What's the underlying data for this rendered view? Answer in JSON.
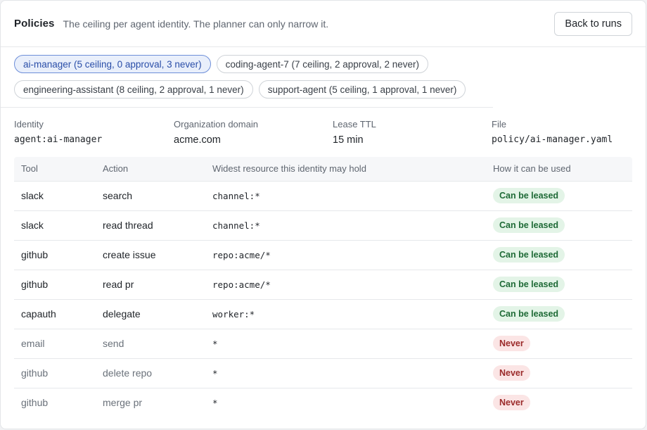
{
  "header": {
    "title": "Policies",
    "subtitle": "The ceiling per agent identity. The planner can only narrow it.",
    "back_label": "Back to runs"
  },
  "chips": [
    {
      "label": "ai-manager (5 ceiling, 0 approval, 3 never)",
      "active": true
    },
    {
      "label": "coding-agent-7 (7 ceiling, 2 approval, 2 never)",
      "active": false
    },
    {
      "label": "engineering-assistant (8 ceiling, 2 approval, 1 never)",
      "active": false
    },
    {
      "label": "support-agent (5 ceiling, 1 approval, 1 never)",
      "active": false
    }
  ],
  "meta": {
    "identity_label": "Identity",
    "identity_value": "agent:ai-manager",
    "domain_label": "Organization domain",
    "domain_value": "acme.com",
    "ttl_label": "Lease TTL",
    "ttl_value": "15 min",
    "file_label": "File",
    "file_value": "policy/ai-manager.yaml"
  },
  "table": {
    "headers": [
      "Tool",
      "Action",
      "Widest resource this identity may hold",
      "How it can be used"
    ],
    "rows": [
      {
        "tool": "slack",
        "action": "search",
        "resource": "channel:*",
        "usage": "Can be leased",
        "status": "leased"
      },
      {
        "tool": "slack",
        "action": "read thread",
        "resource": "channel:*",
        "usage": "Can be leased",
        "status": "leased"
      },
      {
        "tool": "github",
        "action": "create issue",
        "resource": "repo:acme/*",
        "usage": "Can be leased",
        "status": "leased"
      },
      {
        "tool": "github",
        "action": "read pr",
        "resource": "repo:acme/*",
        "usage": "Can be leased",
        "status": "leased"
      },
      {
        "tool": "capauth",
        "action": "delegate",
        "resource": "worker:*",
        "usage": "Can be leased",
        "status": "leased"
      },
      {
        "tool": "email",
        "action": "send",
        "resource": "*",
        "usage": "Never",
        "status": "never"
      },
      {
        "tool": "github",
        "action": "delete repo",
        "resource": "*",
        "usage": "Never",
        "status": "never"
      },
      {
        "tool": "github",
        "action": "merge pr",
        "resource": "*",
        "usage": "Never",
        "status": "never"
      }
    ]
  },
  "colors": {
    "accent": "#2a4ea8",
    "leased_bg": "#e3f4e7",
    "leased_fg": "#1e6a36",
    "never_bg": "#fbe5e5",
    "never_fg": "#9b2a2a"
  }
}
